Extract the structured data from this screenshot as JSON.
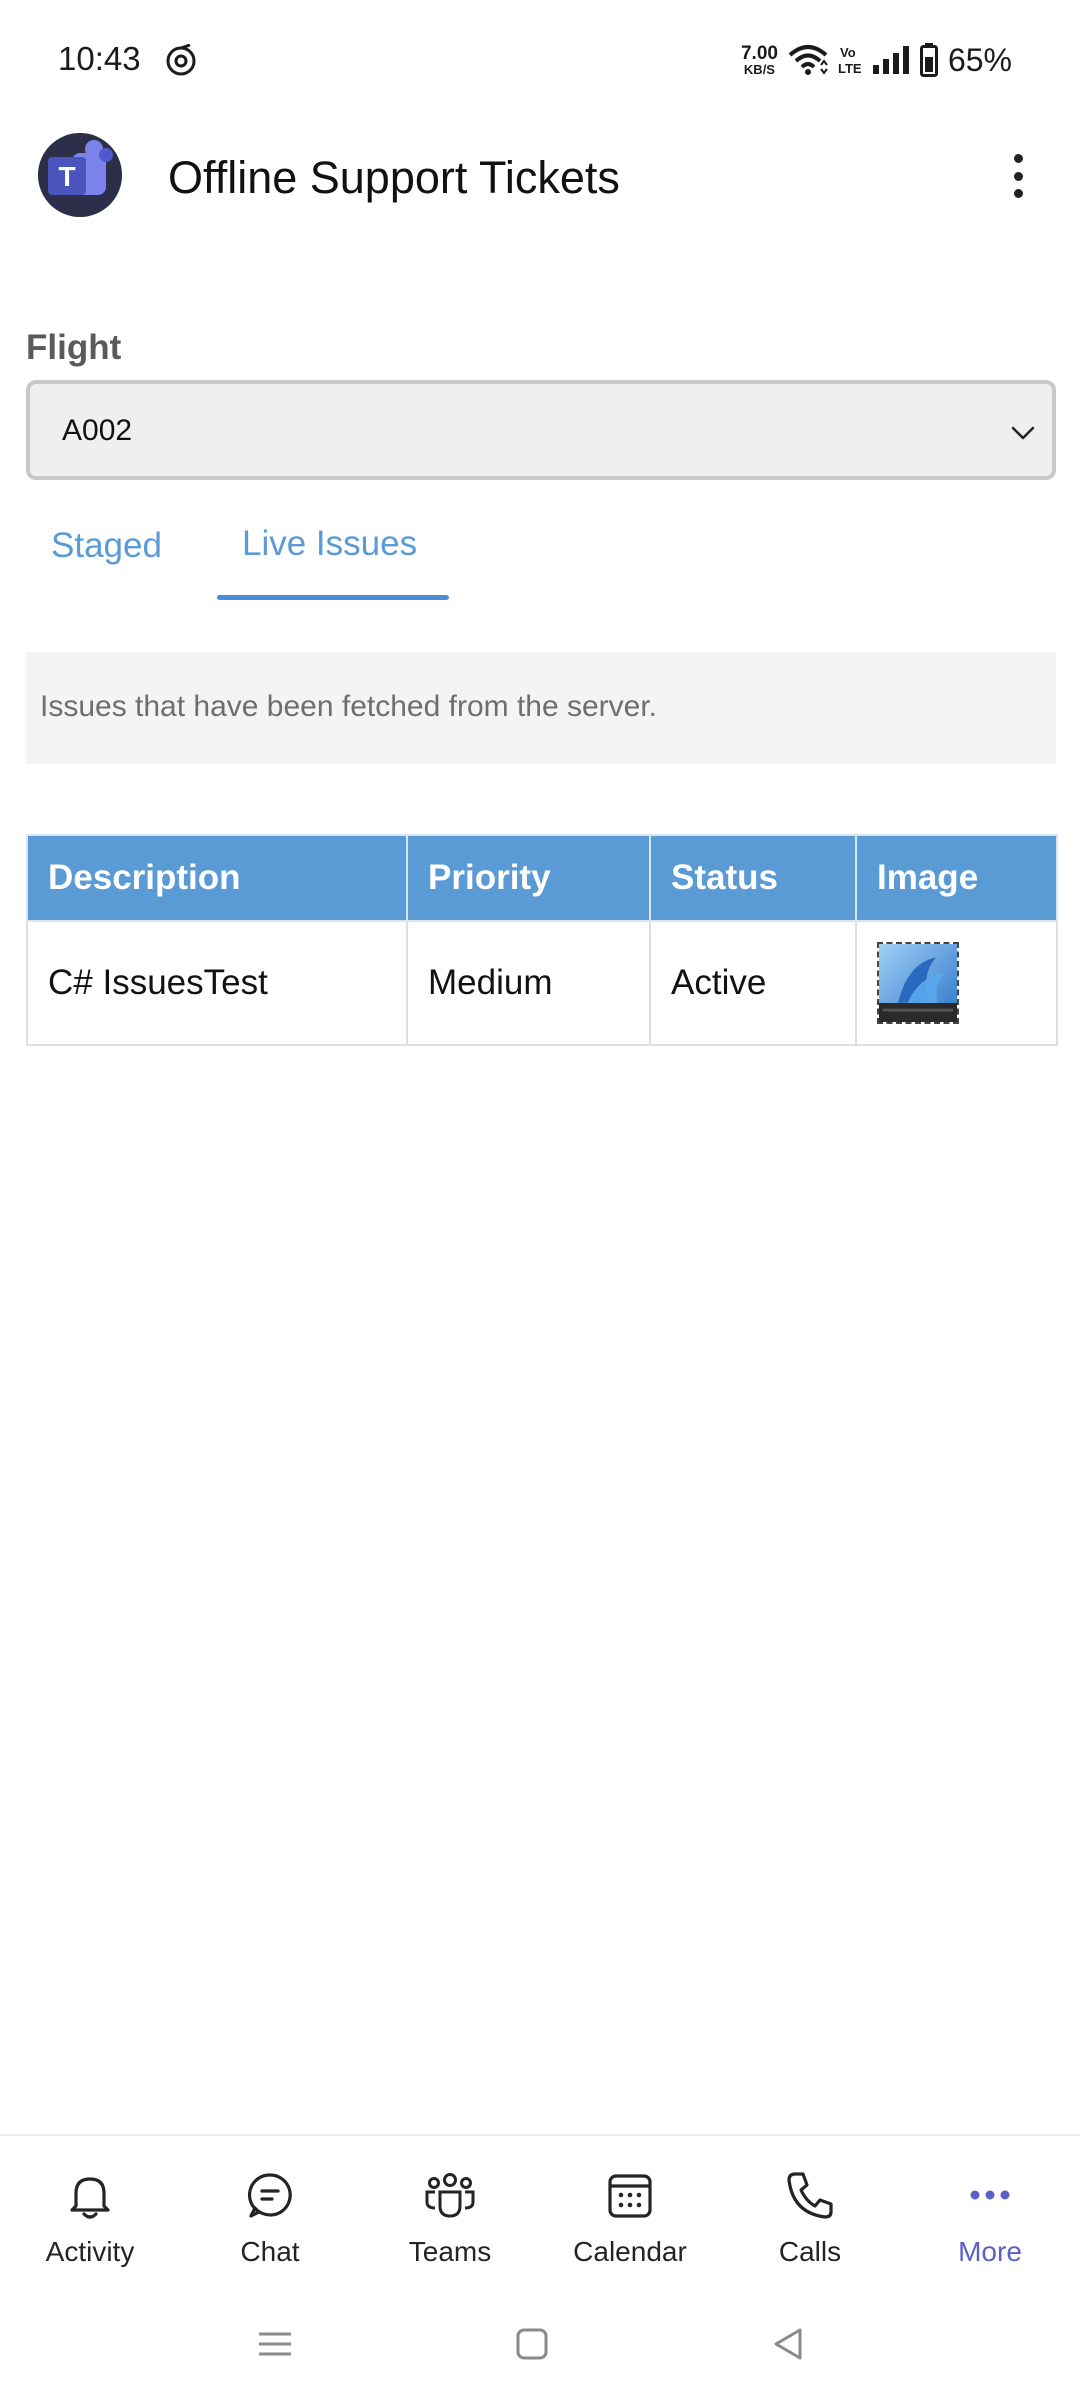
{
  "status_bar": {
    "time": "10:43",
    "net_speed_value": "7.00",
    "net_speed_unit": "KB/S",
    "volte": "Vo LTE",
    "battery": "65%"
  },
  "header": {
    "title": "Offline Support Tickets",
    "app_icon": "teams-logo"
  },
  "flight": {
    "label": "Flight",
    "selected": "A002"
  },
  "tabs": [
    {
      "label": "Staged",
      "active": false
    },
    {
      "label": "Live Issues",
      "active": true
    }
  ],
  "info": {
    "text": "Issues that have been fetched from the server."
  },
  "table": {
    "headers": [
      "Description",
      "Priority",
      "Status",
      "Image"
    ],
    "rows": [
      {
        "description": "C# IssuesTest",
        "priority": "Medium",
        "status": "Active",
        "image": "windows-wallpaper-thumbnail"
      }
    ]
  },
  "bottom_nav": [
    {
      "label": "Activity",
      "icon": "bell-icon",
      "active": false
    },
    {
      "label": "Chat",
      "icon": "chat-icon",
      "active": false
    },
    {
      "label": "Teams",
      "icon": "teams-icon",
      "active": false
    },
    {
      "label": "Calendar",
      "icon": "calendar-icon",
      "active": false
    },
    {
      "label": "Calls",
      "icon": "phone-icon",
      "active": false
    },
    {
      "label": "More",
      "icon": "more-dots-icon",
      "active": true
    }
  ],
  "colors": {
    "accent_blue": "#5b9bd5",
    "teams_purple": "#5b5fc7"
  }
}
